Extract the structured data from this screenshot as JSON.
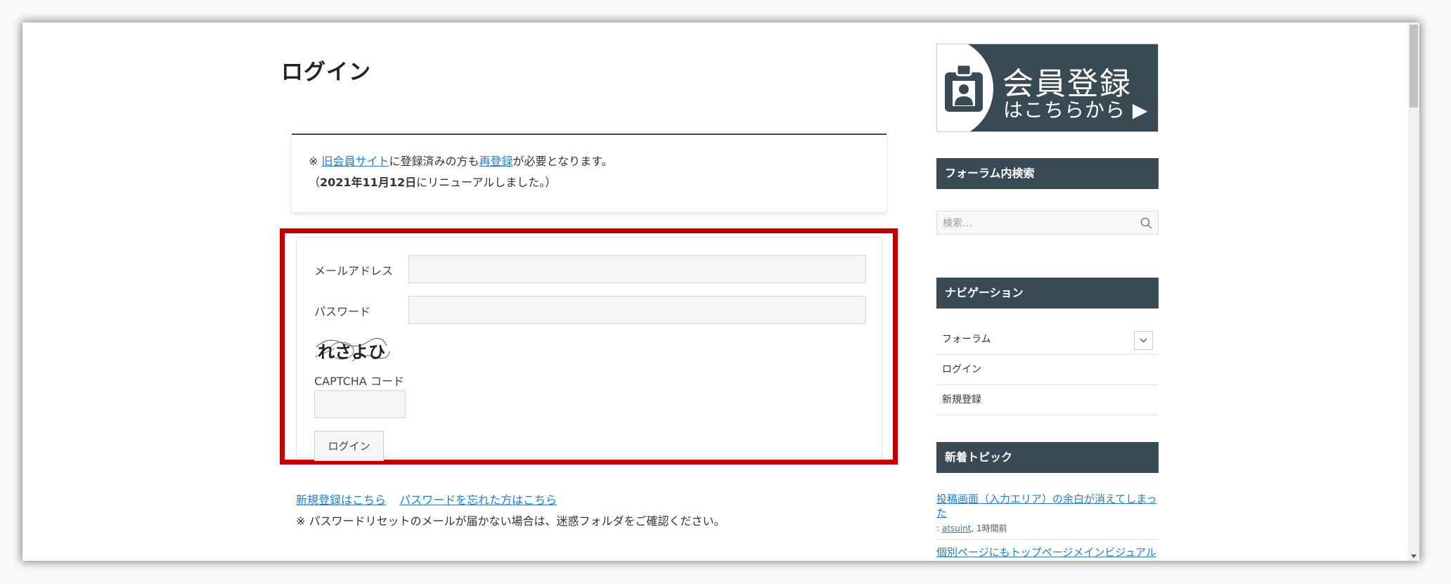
{
  "page": {
    "title": "ログイン"
  },
  "notice": {
    "prefix": "※",
    "link_old_site": "旧会員サイト",
    "text_mid": "に登録済みの方も",
    "link_reregister": "再登録",
    "text_end": "が必要となります。",
    "renewal_open": "（",
    "renewal_date": "2021年11月12日",
    "renewal_end": "にリニューアルしました。）"
  },
  "form": {
    "email_label": "メールアドレス",
    "email_value": "",
    "password_label": "パスワード",
    "password_value": "",
    "captcha_image_text": "れさよひ",
    "captcha_label": "CAPTCHA コード",
    "captcha_value": "",
    "submit_label": "ログイン"
  },
  "links": {
    "register": "新規登録はこちら",
    "forgot_password": "パスワードを忘れた方はこちら",
    "reset_note": "※ パスワードリセットのメールが届かない場合は、迷惑フォルダをご確認ください。"
  },
  "sidebar": {
    "banner_line1": "会員登録",
    "banner_line2": "はこちらから ▶",
    "search_heading": "フォーラム内検索",
    "search_placeholder": "検索…",
    "nav_heading": "ナビゲーション",
    "nav_items": [
      {
        "label": "フォーラム"
      },
      {
        "label": "ログイン"
      },
      {
        "label": "新規登録"
      }
    ],
    "topics_heading": "新着トピック",
    "topics": [
      {
        "title": "投稿画面（入力エリア）の余白が消えてしまった",
        "meta_prefix": ": ",
        "author": "atsuint",
        "meta_time": ", 1時間前"
      },
      {
        "title": "個別ページにもトップページメインビジュアル"
      }
    ]
  },
  "colors": {
    "accent_dark": "#3a4a55",
    "link": "#2a7bbf",
    "highlight_border": "#c00000"
  }
}
